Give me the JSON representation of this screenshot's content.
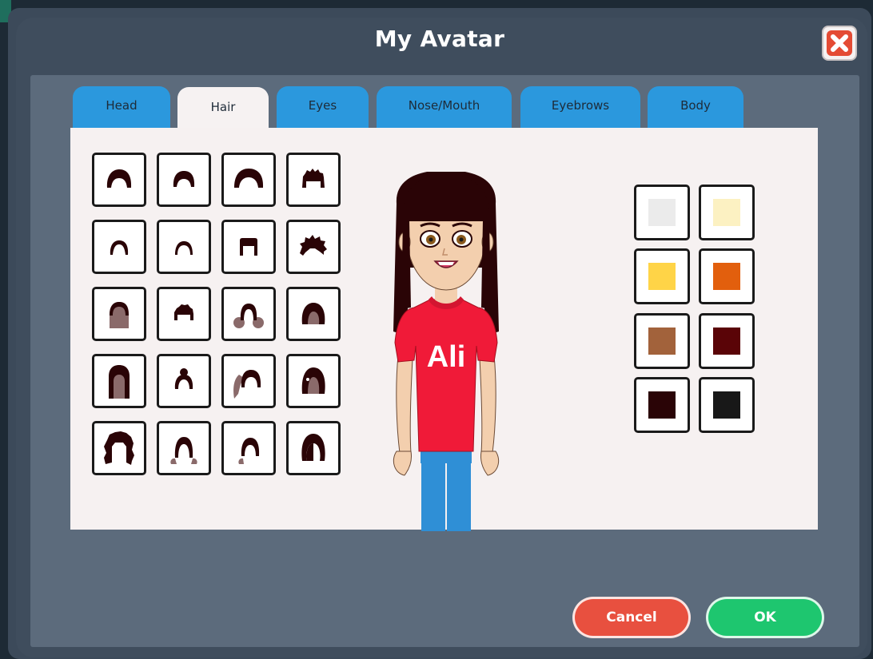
{
  "window": {
    "title": "My Avatar"
  },
  "tabs": [
    {
      "label": "Head"
    },
    {
      "label": "Hair"
    },
    {
      "label": "Eyes"
    },
    {
      "label": "Nose/Mouth"
    },
    {
      "label": "Eyebrows"
    },
    {
      "label": "Body"
    }
  ],
  "active_tab": "Hair",
  "hair_styles_count": 20,
  "hair_colors": [
    "#ebebeb",
    "#fcf1c2",
    "#ffd447",
    "#e25f0d",
    "#a2623b",
    "#5a0407",
    "#2a0406",
    "#181818"
  ],
  "avatar": {
    "shirt_text": "Ali",
    "shirt_color": "#f01a38",
    "hair_color": "#2a0406"
  },
  "buttons": {
    "cancel": "Cancel",
    "ok": "OK"
  },
  "colors": {
    "tab_blue": "#2b98dd",
    "panel": "#5c6b7c",
    "cancel_red": "#e8503f",
    "ok_green": "#1ec66f"
  }
}
